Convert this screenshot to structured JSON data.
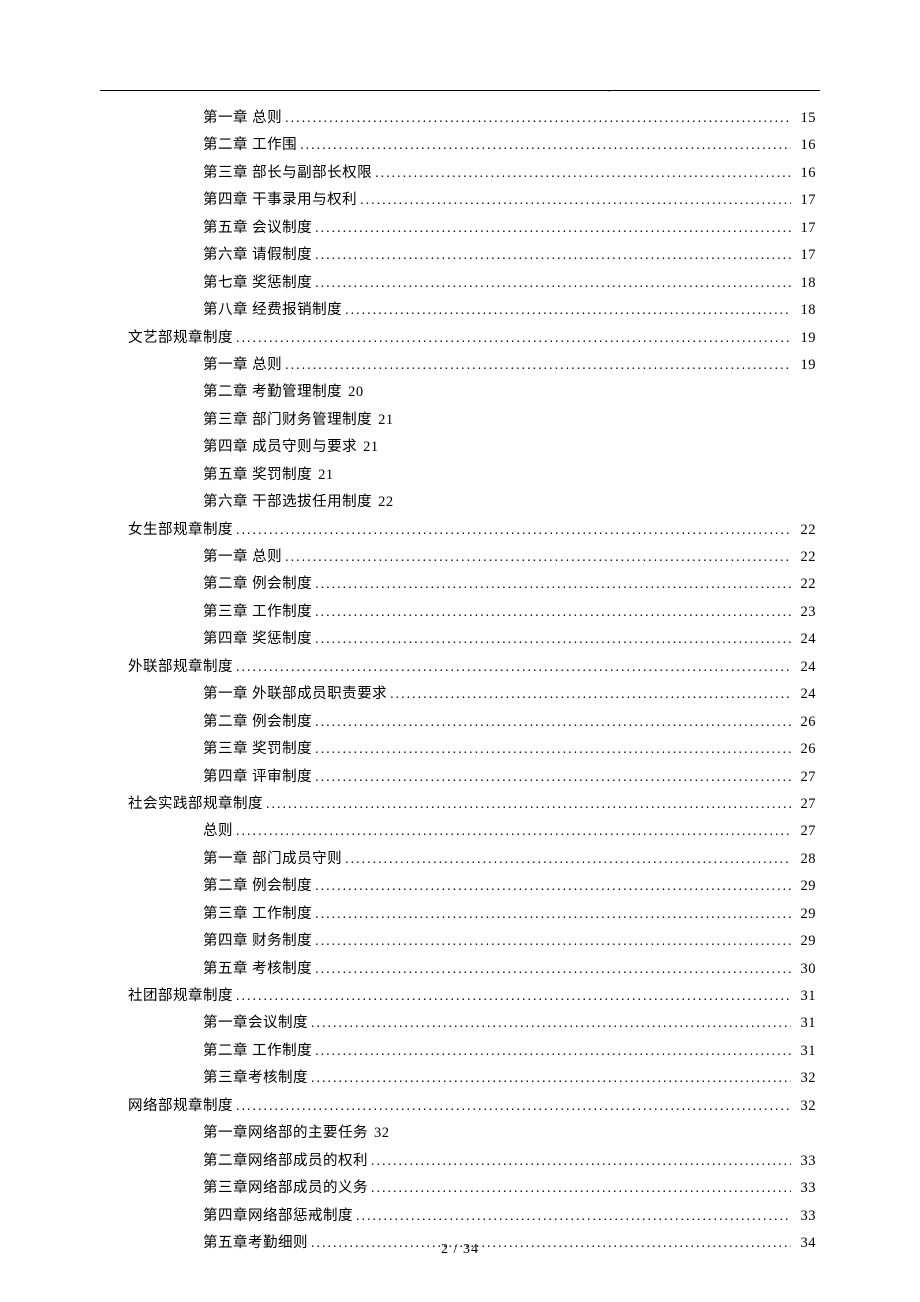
{
  "footer": {
    "current_page": "2",
    "separator": " / ",
    "total_pages": "34"
  },
  "toc": [
    {
      "indent": 1,
      "label": "第一章 总则",
      "page": "15",
      "leader": true
    },
    {
      "indent": 1,
      "label": "第二章 工作围",
      "page": "16",
      "leader": true
    },
    {
      "indent": 1,
      "label": "第三章 部长与副部长权限",
      "page": "16",
      "leader": true
    },
    {
      "indent": 1,
      "label": "第四章 干事录用与权利",
      "page": "17",
      "leader": true
    },
    {
      "indent": 1,
      "label": "第五章 会议制度",
      "page": "17",
      "leader": true
    },
    {
      "indent": 1,
      "label": "第六章 请假制度",
      "page": "17",
      "leader": true
    },
    {
      "indent": 1,
      "label": "第七章 奖惩制度",
      "page": "18",
      "leader": true
    },
    {
      "indent": 1,
      "label": "第八章 经费报销制度",
      "page": "18",
      "leader": true
    },
    {
      "indent": 0,
      "label": "文艺部规章制度",
      "page": "19",
      "leader": true
    },
    {
      "indent": 1,
      "label": "第一章 总则",
      "page": "19",
      "leader": true
    },
    {
      "indent": 1,
      "label": "第二章 考勤管理制度",
      "page": "20",
      "leader": false
    },
    {
      "indent": 1,
      "label": "第三章 部门财务管理制度",
      "page": "21",
      "leader": false
    },
    {
      "indent": 1,
      "label": "第四章 成员守则与要求",
      "page": "21",
      "leader": false
    },
    {
      "indent": 1,
      "label": "第五章 奖罚制度",
      "page": "21",
      "leader": false
    },
    {
      "indent": 1,
      "label": "第六章 干部选拔任用制度",
      "page": "22",
      "leader": false
    },
    {
      "indent": 0,
      "label": "女生部规章制度",
      "page": "22",
      "leader": true
    },
    {
      "indent": 1,
      "label": "第一章 总则",
      "page": "22",
      "leader": true
    },
    {
      "indent": 1,
      "label": "第二章 例会制度",
      "page": "22",
      "leader": true
    },
    {
      "indent": 1,
      "label": "第三章 工作制度",
      "page": "23",
      "leader": true
    },
    {
      "indent": 1,
      "label": "第四章 奖惩制度",
      "page": "24",
      "leader": true
    },
    {
      "indent": 0,
      "label": "外联部规章制度",
      "page": "24",
      "leader": true
    },
    {
      "indent": 1,
      "label": "第一章 外联部成员职责要求",
      "page": "24",
      "leader": true
    },
    {
      "indent": 1,
      "label": "第二章 例会制度",
      "page": "26",
      "leader": true
    },
    {
      "indent": 1,
      "label": "第三章 奖罚制度",
      "page": "26",
      "leader": true
    },
    {
      "indent": 1,
      "label": "第四章 评审制度",
      "page": "27",
      "leader": true
    },
    {
      "indent": 0,
      "label": "社会实践部规章制度",
      "page": "27",
      "leader": true
    },
    {
      "indent": 1,
      "label": "总则",
      "page": "27",
      "leader": true
    },
    {
      "indent": 1,
      "label": "第一章  部门成员守则",
      "page": "28",
      "leader": true
    },
    {
      "indent": 1,
      "label": "第二章  例会制度",
      "page": "29",
      "leader": true
    },
    {
      "indent": 1,
      "label": "第三章  工作制度",
      "page": "29",
      "leader": true
    },
    {
      "indent": 1,
      "label": "第四章  财务制度",
      "page": "29",
      "leader": true
    },
    {
      "indent": 1,
      "label": "第五章  考核制度",
      "page": "30",
      "leader": true
    },
    {
      "indent": 0,
      "label": "社团部规章制度",
      "page": "31",
      "leader": true
    },
    {
      "indent": 1,
      "label": "第一章会议制度",
      "page": "31",
      "leader": true
    },
    {
      "indent": 1,
      "label": "第二章 工作制度",
      "page": "31",
      "leader": true
    },
    {
      "indent": 1,
      "label": "第三章考核制度",
      "page": "32",
      "leader": true
    },
    {
      "indent": 0,
      "label": "网络部规章制度",
      "page": "32",
      "leader": true
    },
    {
      "indent": 1,
      "label": "第一章网络部的主要任务",
      "page": "32",
      "leader": false
    },
    {
      "indent": 1,
      "label": "第二章网络部成员的权利",
      "page": "33",
      "leader": true
    },
    {
      "indent": 1,
      "label": "第三章网络部成员的义务",
      "page": "33",
      "leader": true
    },
    {
      "indent": 1,
      "label": "第四章网络部惩戒制度",
      "page": "33",
      "leader": true
    },
    {
      "indent": 1,
      "label": "第五章考勤细则",
      "page": "34",
      "leader": true
    }
  ]
}
